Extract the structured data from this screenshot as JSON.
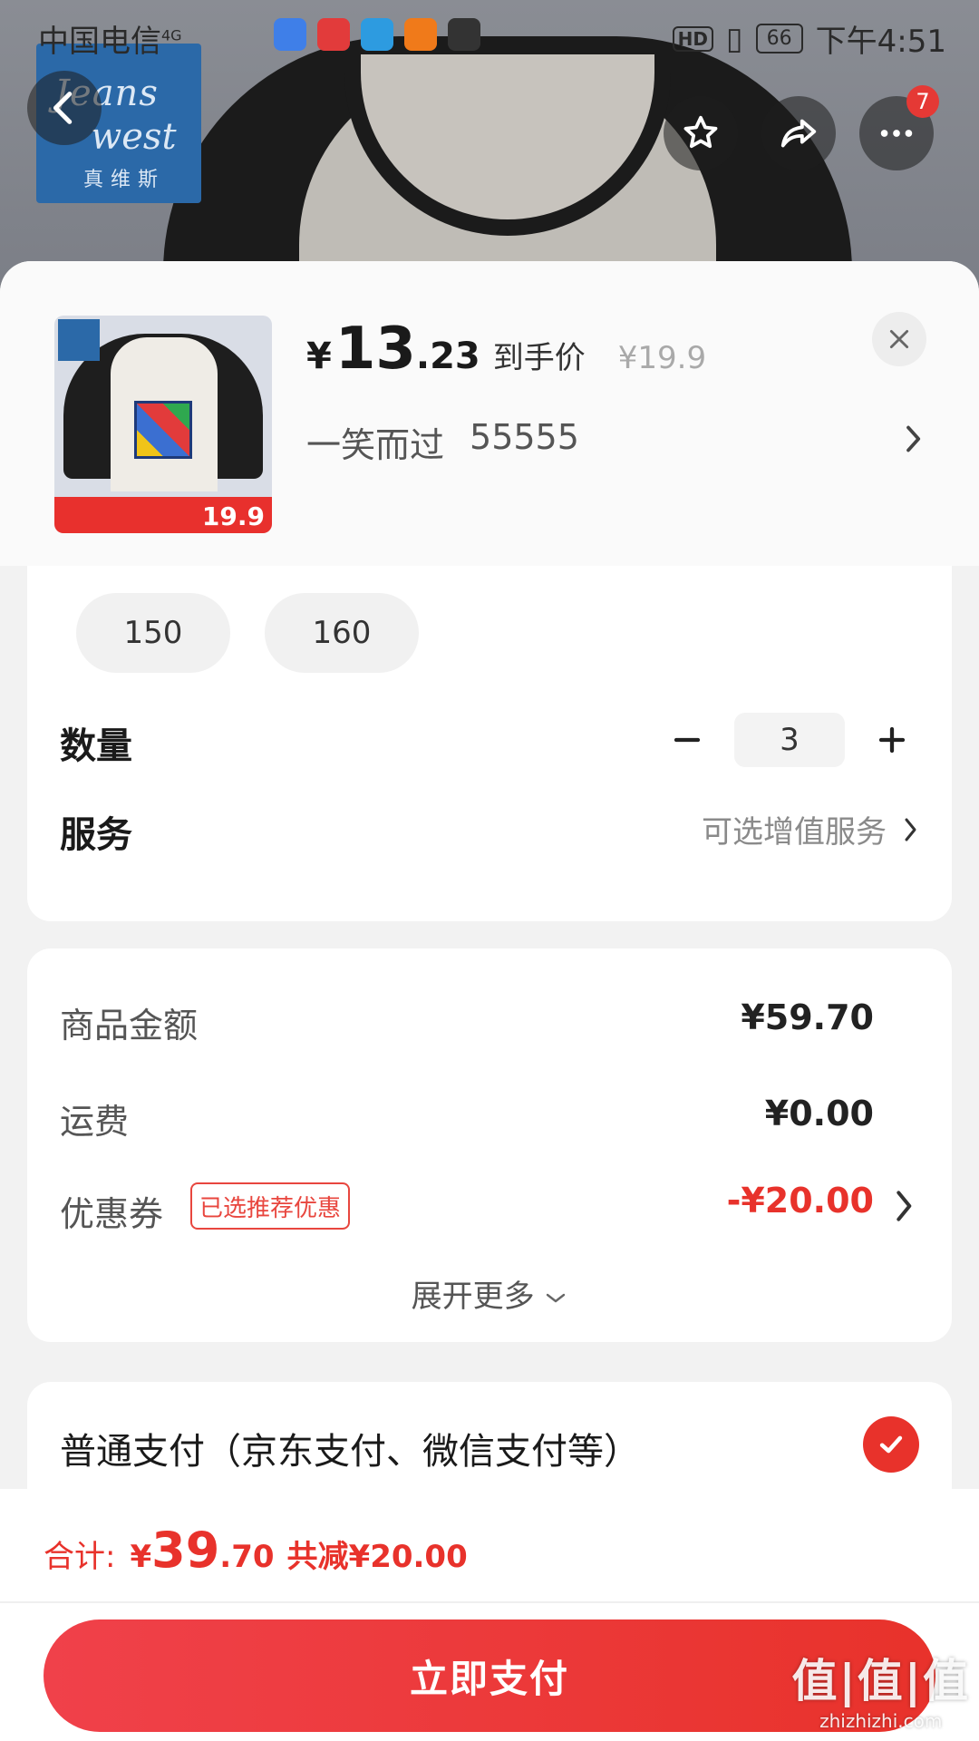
{
  "status_bar": {
    "carrier": "中国电信",
    "network": "4G",
    "hd": "HD",
    "battery": "66",
    "time": "下午4:51"
  },
  "header": {
    "brand_line1": "Jeans",
    "brand_line2": "west",
    "brand_cn": "真维斯",
    "more_badge": "7"
  },
  "product": {
    "price_currency": "¥",
    "price_int": "13",
    "price_dec": ".23",
    "price_tag": "到手价",
    "original_price": "¥19.9",
    "selected_style": "一笑而过",
    "selected_size": "55555",
    "thumb_price": "19.9"
  },
  "sizes": [
    "150",
    "160"
  ],
  "quantity": {
    "label": "数量",
    "value": "3",
    "minus_label": "−",
    "plus_label": "+"
  },
  "service": {
    "label": "服务",
    "value": "可选增值服务"
  },
  "summary": {
    "goods_label": "商品金额",
    "goods_value": "¥59.70",
    "shipping_label": "运费",
    "shipping_value": "¥0.00",
    "coupon_label": "优惠券",
    "coupon_tag": "已选推荐优惠",
    "coupon_value": "-¥20.00",
    "expand_label": "展开更多"
  },
  "payment": {
    "method_label": "普通支付（京东支付、微信支付等）"
  },
  "footer": {
    "total_label": "合计:",
    "total_currency": "¥",
    "total_int": "39",
    "total_dec": ".70",
    "saved": "共减¥20.00",
    "pay_button": "立即支付"
  },
  "watermark": {
    "main": "值|值|值",
    "sub": "zhizhizhi.com"
  },
  "colors": {
    "accent": "#e8322b",
    "sheet_bg": "#f2f2f2"
  },
  "icons": [
    "back-icon",
    "star-icon",
    "share-icon",
    "more-icon",
    "close-icon",
    "chevron-right-icon",
    "chevron-down-icon",
    "minus-icon",
    "plus-icon",
    "check-icon"
  ]
}
